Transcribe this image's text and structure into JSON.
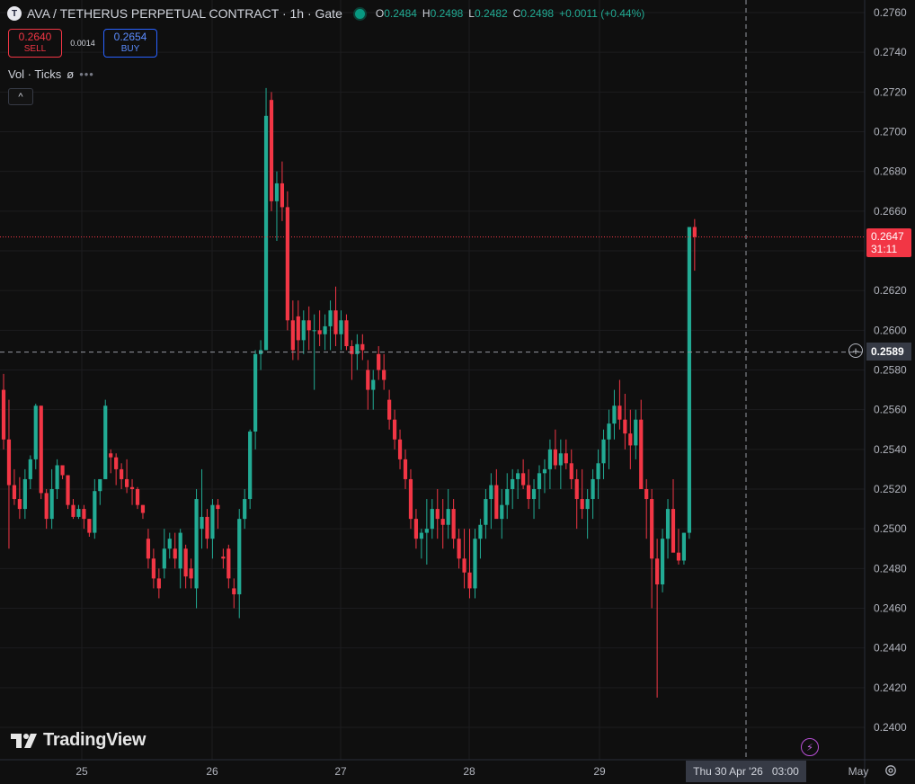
{
  "legend": {
    "symbol_icon": "T",
    "title": "AVA / TETHERUS PERPETUAL CONTRACT · 1h · Gate",
    "status_color": "#089981",
    "ohlc": {
      "o_label": "O",
      "o_value": "0.2484",
      "h_label": "H",
      "h_value": "0.2498",
      "l_label": "L",
      "l_value": "0.2482",
      "c_label": "C",
      "c_value": "0.2498",
      "change": "+0.0011 (+0.44%)"
    }
  },
  "trade": {
    "sell_price": "0.2640",
    "sell_label": "SELL",
    "spread": "0.0014",
    "buy_price": "0.2654",
    "buy_label": "BUY"
  },
  "volume_legend": {
    "label": "Vol · Ticks",
    "value": "ø",
    "more": "•••"
  },
  "collapse_icon": "^",
  "logo": {
    "text": "TradingView"
  },
  "price_axis": {
    "ticks": [
      "0.2760",
      "0.2740",
      "0.2720",
      "0.2700",
      "0.2680",
      "0.2660",
      "0.2640",
      "0.2620",
      "0.2600",
      "0.2580",
      "0.2560",
      "0.2540",
      "0.2520",
      "0.2500",
      "0.2480",
      "0.2460",
      "0.2440",
      "0.2420",
      "0.2400"
    ],
    "last_price": "0.2647",
    "countdown": "31:11",
    "crosshair_price": "0.2589"
  },
  "time_axis": {
    "labels": [
      "25",
      "26",
      "27",
      "28",
      "29",
      "May"
    ],
    "crosshair_date": "Thu 30 Apr '26",
    "crosshair_time": "03:00"
  },
  "colors": {
    "up": "#22ab94",
    "down": "#f23645",
    "bg": "#0f0f0f",
    "grid": "#1c1c1f"
  },
  "chart_data": {
    "type": "candlestick",
    "symbol": "AVA / TETHERUS PERPETUAL CONTRACT",
    "interval": "1h",
    "exchange": "Gate",
    "ylim": [
      0.2395,
      0.2768
    ],
    "y_ticks": [
      0.276,
      0.274,
      0.272,
      0.27,
      0.268,
      0.266,
      0.264,
      0.262,
      0.26,
      0.258,
      0.256,
      0.254,
      0.252,
      0.25,
      0.248,
      0.246,
      0.244,
      0.242,
      0.24
    ],
    "x_tick_labels": [
      "25",
      "26",
      "27",
      "28",
      "29",
      "May"
    ],
    "bar_count": 130,
    "last_price": 0.2647,
    "crosshair_price": 0.2589,
    "candles": [
      [
        0.257,
        0.2578,
        0.254,
        0.2545
      ],
      [
        0.2545,
        0.2565,
        0.249,
        0.2522
      ],
      [
        0.2522,
        0.253,
        0.2512,
        0.2515
      ],
      [
        0.2515,
        0.2526,
        0.2505,
        0.251
      ],
      [
        0.251,
        0.253,
        0.2505,
        0.2525
      ],
      [
        0.2525,
        0.2537,
        0.252,
        0.2535
      ],
      [
        0.2535,
        0.2563,
        0.253,
        0.2562
      ],
      [
        0.2562,
        0.2562,
        0.2515,
        0.2518
      ],
      [
        0.2518,
        0.252,
        0.25,
        0.2505
      ],
      [
        0.2505,
        0.253,
        0.25,
        0.252
      ],
      [
        0.252,
        0.2535,
        0.2515,
        0.2532
      ],
      [
        0.2532,
        0.2532,
        0.2525,
        0.2527
      ],
      [
        0.2527,
        0.2527,
        0.251,
        0.2512
      ],
      [
        0.2512,
        0.2515,
        0.2505,
        0.2506
      ],
      [
        0.2506,
        0.2512,
        0.2505,
        0.251
      ],
      [
        0.251,
        0.2512,
        0.25,
        0.2505
      ],
      [
        0.2505,
        0.2505,
        0.2496,
        0.2498
      ],
      [
        0.2498,
        0.2525,
        0.2495,
        0.2519
      ],
      [
        0.2519,
        0.2523,
        0.2512,
        0.2525
      ],
      [
        0.2525,
        0.2565,
        0.2525,
        0.2562
      ],
      [
        0.2538,
        0.254,
        0.2528,
        0.2536
      ],
      [
        0.2536,
        0.2538,
        0.2522,
        0.253
      ],
      [
        0.253,
        0.2533,
        0.252,
        0.2525
      ],
      [
        0.2525,
        0.2535,
        0.2518,
        0.2521
      ],
      [
        0.2521,
        0.2525,
        0.2512,
        0.252
      ],
      [
        0.252,
        0.2521,
        0.251,
        0.2512
      ],
      [
        0.2512,
        0.2512,
        0.2505,
        0.2508
      ],
      [
        0.2495,
        0.25,
        0.248,
        0.2485
      ],
      [
        0.2485,
        0.249,
        0.247,
        0.2475
      ],
      [
        0.2475,
        0.248,
        0.2465,
        0.247
      ],
      [
        0.248,
        0.25,
        0.2475,
        0.249
      ],
      [
        0.249,
        0.2498,
        0.2485,
        0.2495
      ],
      [
        0.249,
        0.2498,
        0.248,
        0.2485
      ],
      [
        0.248,
        0.25,
        0.247,
        0.2498
      ],
      [
        0.249,
        0.2492,
        0.247,
        0.2476
      ],
      [
        0.248,
        0.2485,
        0.247,
        0.2475
      ],
      [
        0.247,
        0.252,
        0.246,
        0.2515
      ],
      [
        0.25,
        0.253,
        0.249,
        0.2506
      ],
      [
        0.2506,
        0.251,
        0.249,
        0.2495
      ],
      [
        0.2495,
        0.2515,
        0.2485,
        0.2512
      ],
      [
        0.2512,
        0.2515,
        0.25,
        0.251
      ],
      [
        0.2486,
        0.249,
        0.248,
        0.2485
      ],
      [
        0.249,
        0.2492,
        0.247,
        0.2475
      ],
      [
        0.247,
        0.2475,
        0.246,
        0.2467
      ],
      [
        0.2467,
        0.251,
        0.2455,
        0.2505
      ],
      [
        0.2505,
        0.252,
        0.25,
        0.2515
      ],
      [
        0.2515,
        0.255,
        0.251,
        0.2549
      ],
      [
        0.2549,
        0.259,
        0.254,
        0.2588
      ],
      [
        0.2588,
        0.2595,
        0.258,
        0.259
      ],
      [
        0.259,
        0.2722,
        0.259,
        0.2708
      ],
      [
        0.2716,
        0.272,
        0.266,
        0.2665
      ],
      [
        0.2665,
        0.268,
        0.2645,
        0.2674
      ],
      [
        0.2674,
        0.2685,
        0.2655,
        0.2662
      ],
      [
        0.2662,
        0.267,
        0.26,
        0.2605
      ],
      [
        0.2605,
        0.2615,
        0.2585,
        0.259
      ],
      [
        0.2607,
        0.2615,
        0.2585,
        0.2595
      ],
      [
        0.2595,
        0.261,
        0.2588,
        0.2605
      ],
      [
        0.2605,
        0.2612,
        0.259,
        0.26
      ],
      [
        0.26,
        0.2608,
        0.257,
        0.26
      ],
      [
        0.26,
        0.261,
        0.2592,
        0.2598
      ],
      [
        0.2598,
        0.2608,
        0.259,
        0.2602
      ],
      [
        0.2602,
        0.2615,
        0.259,
        0.261
      ],
      [
        0.261,
        0.2622,
        0.2592,
        0.2598
      ],
      [
        0.2598,
        0.261,
        0.259,
        0.2605
      ],
      [
        0.2605,
        0.2608,
        0.259,
        0.2592
      ],
      [
        0.2592,
        0.2595,
        0.2575,
        0.2588
      ],
      [
        0.2588,
        0.2598,
        0.258,
        0.2593
      ],
      [
        0.2593,
        0.2598,
        0.2585,
        0.259
      ],
      [
        0.258,
        0.2585,
        0.256,
        0.257
      ],
      [
        0.257,
        0.258,
        0.256,
        0.2575
      ],
      [
        0.2588,
        0.2592,
        0.2575,
        0.258
      ],
      [
        0.258,
        0.2588,
        0.257,
        0.2575
      ],
      [
        0.2565,
        0.257,
        0.255,
        0.2555
      ],
      [
        0.2555,
        0.256,
        0.254,
        0.2545
      ],
      [
        0.2545,
        0.255,
        0.253,
        0.2535
      ],
      [
        0.2535,
        0.254,
        0.252,
        0.2525
      ],
      [
        0.2525,
        0.253,
        0.25,
        0.2505
      ],
      [
        0.2505,
        0.251,
        0.249,
        0.2495
      ],
      [
        0.2495,
        0.25,
        0.2485,
        0.2498
      ],
      [
        0.2498,
        0.2515,
        0.2482,
        0.25
      ],
      [
        0.25,
        0.2515,
        0.2495,
        0.251
      ],
      [
        0.251,
        0.252,
        0.2495,
        0.2505
      ],
      [
        0.2505,
        0.2515,
        0.249,
        0.2502
      ],
      [
        0.2502,
        0.252,
        0.2495,
        0.251
      ],
      [
        0.251,
        0.2515,
        0.249,
        0.2495
      ],
      [
        0.2495,
        0.25,
        0.248,
        0.2485
      ],
      [
        0.2485,
        0.25,
        0.247,
        0.2478
      ],
      [
        0.2478,
        0.25,
        0.2465,
        0.247
      ],
      [
        0.247,
        0.25,
        0.2465,
        0.2495
      ],
      [
        0.2495,
        0.2505,
        0.2485,
        0.2502
      ],
      [
        0.2502,
        0.252,
        0.2495,
        0.2515
      ],
      [
        0.2515,
        0.2528,
        0.25,
        0.2522
      ],
      [
        0.2522,
        0.253,
        0.251,
        0.2505
      ],
      [
        0.2505,
        0.252,
        0.2495,
        0.2512
      ],
      [
        0.2512,
        0.2528,
        0.2505,
        0.252
      ],
      [
        0.252,
        0.253,
        0.251,
        0.2525
      ],
      [
        0.2525,
        0.253,
        0.2515,
        0.2528
      ],
      [
        0.2528,
        0.2535,
        0.252,
        0.2522
      ],
      [
        0.2522,
        0.253,
        0.251,
        0.2515
      ],
      [
        0.2515,
        0.2525,
        0.2505,
        0.252
      ],
      [
        0.252,
        0.2532,
        0.251,
        0.2528
      ],
      [
        0.2528,
        0.2535,
        0.2518,
        0.253
      ],
      [
        0.253,
        0.2545,
        0.252,
        0.254
      ],
      [
        0.254,
        0.255,
        0.253,
        0.2532
      ],
      [
        0.2532,
        0.2545,
        0.252,
        0.2538
      ],
      [
        0.2538,
        0.2545,
        0.253,
        0.2533
      ],
      [
        0.2533,
        0.254,
        0.252,
        0.2525
      ],
      [
        0.2525,
        0.253,
        0.25,
        0.2515
      ],
      [
        0.2515,
        0.253,
        0.2505,
        0.251
      ],
      [
        0.251,
        0.252,
        0.2495,
        0.2515
      ],
      [
        0.2515,
        0.253,
        0.2505,
        0.2525
      ],
      [
        0.2525,
        0.254,
        0.2515,
        0.2533
      ],
      [
        0.2533,
        0.255,
        0.2525,
        0.2545
      ],
      [
        0.2545,
        0.256,
        0.253,
        0.2553
      ],
      [
        0.2553,
        0.257,
        0.2545,
        0.2562
      ],
      [
        0.2562,
        0.2575,
        0.255,
        0.2555
      ],
      [
        0.2555,
        0.2568,
        0.254,
        0.2548
      ],
      [
        0.2548,
        0.256,
        0.253,
        0.2542
      ],
      [
        0.2542,
        0.256,
        0.2535,
        0.2555
      ],
      [
        0.2555,
        0.2565,
        0.254,
        0.252
      ],
      [
        0.252,
        0.2525,
        0.2495,
        0.2515
      ],
      [
        0.2515,
        0.252,
        0.246,
        0.2485
      ],
      [
        0.2485,
        0.2495,
        0.2415,
        0.2472
      ],
      [
        0.2472,
        0.25,
        0.2468,
        0.2495
      ],
      [
        0.2495,
        0.2515,
        0.2485,
        0.251
      ],
      [
        0.251,
        0.2525,
        0.25,
        0.2488
      ],
      [
        0.2488,
        0.25,
        0.2482,
        0.2484
      ],
      [
        0.2484,
        0.2498,
        0.2482,
        0.2498
      ],
      [
        0.2498,
        0.2585,
        0.2495,
        0.2652
      ],
      [
        0.2652,
        0.2656,
        0.263,
        0.2647
      ]
    ]
  }
}
